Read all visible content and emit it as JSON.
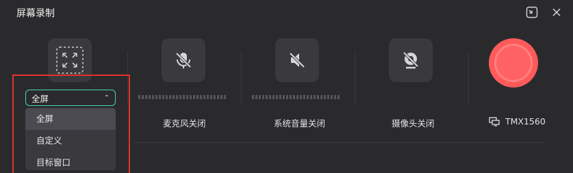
{
  "window": {
    "title": "屏幕录制"
  },
  "sources": {
    "microphone": {
      "label": "麦克风关闭",
      "icon": "microphone-off-icon"
    },
    "system_audio": {
      "label": "系统音量关闭",
      "icon": "speaker-off-icon"
    },
    "camera": {
      "label": "摄像头关闭",
      "icon": "camera-off-icon"
    },
    "screen": {
      "icon": "fullscreen-region-icon"
    }
  },
  "area_select": {
    "selected": "全屏",
    "options": [
      "全屏",
      "自定义",
      "目标窗口"
    ]
  },
  "device": {
    "name": "TMX1560",
    "icon": "monitor-icon"
  },
  "colors": {
    "accent": "#48d6b4",
    "record": "#ff5a5a",
    "highlight": "#e2342c"
  }
}
